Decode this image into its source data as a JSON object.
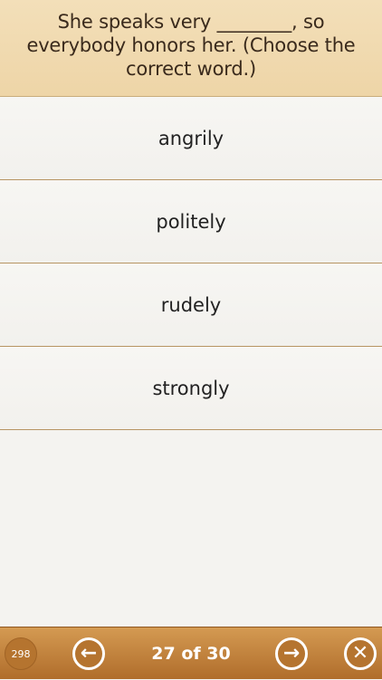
{
  "question": {
    "text": "She speaks very ________, so everybody honors her. (Choose the correct word.)"
  },
  "answers": [
    {
      "label": "angrily"
    },
    {
      "label": "politely"
    },
    {
      "label": "rudely"
    },
    {
      "label": "strongly"
    }
  ],
  "footer": {
    "score": "298",
    "progress": "27 of 30",
    "prev_icon": "arrow-left-icon",
    "next_icon": "arrow-right-icon",
    "close_icon": "close-icon"
  },
  "colors": {
    "header": "#eed5a7",
    "bar": "#c07f3d",
    "divider": "#b79563"
  }
}
